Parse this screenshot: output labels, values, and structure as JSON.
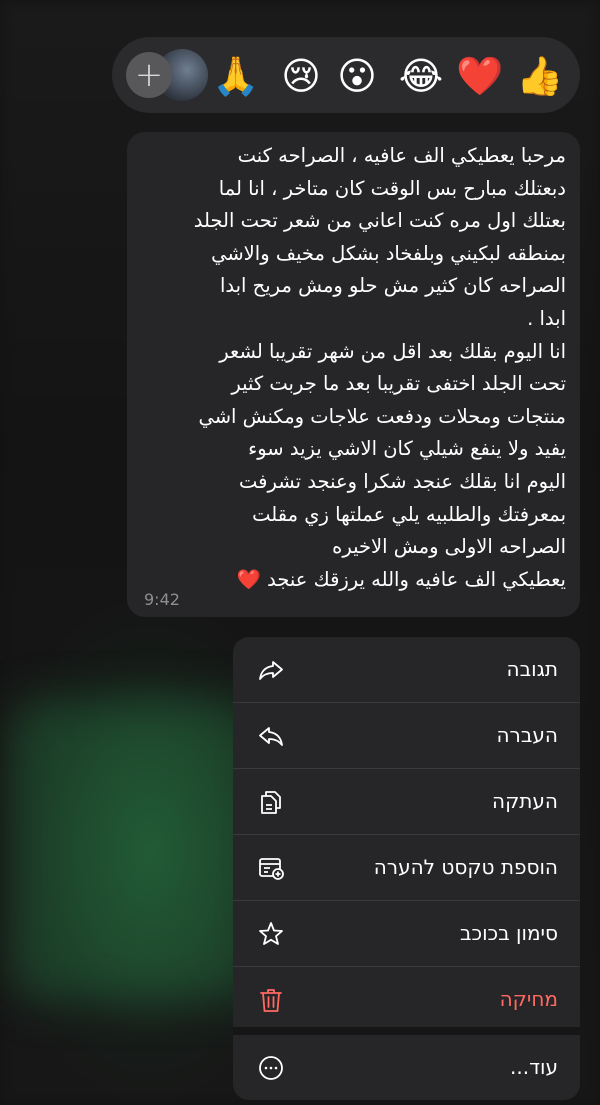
{
  "reactions": {
    "add_label": "+",
    "emojis": [
      "👍",
      "❤️",
      "😂",
      "😮",
      "😢",
      "🙏"
    ]
  },
  "message": {
    "text": "مرحبا يعطيكي الف عافيه ، الصراحه كنت\nدبعتلك مبارح بس الوقت كان متاخر ، انا لما\nبعتلك اول مره كنت اعاني من شعر تحت الجلد\nبمنطقه لبكيني وبلفخاد بشكل مخيف والاشي\nالصراحه كان كثير مش حلو ومش مريح ابدا\nابدا .\nانا اليوم بقلك بعد اقل من شهر تقريبا لشعر\nتحت الجلد اختفى تقريبا بعد ما جربت كثير\nمنتجات ومحلات ودفعت علاجات ومكنش اشي\nيفيد ولا ينفع شيلي كان الاشي يزيد سوء\nاليوم انا بقلك عنجد شكرا وعنجد تشرفت\nبمعرفتك والطلبيه يلي عملتها زي مقلت\nالصراحه الاولى ومش الاخيره\nيعطيكي الف عافيه والله يرزقك عنجد ❤️",
    "time": "9:42"
  },
  "menu": {
    "items": [
      {
        "label": "תגובה",
        "icon": "reply-icon"
      },
      {
        "label": "העברה",
        "icon": "forward-icon"
      },
      {
        "label": "העתקה",
        "icon": "copy-icon"
      },
      {
        "label": "הוספת טקסט להערה",
        "icon": "add-note-icon"
      },
      {
        "label": "סימון בכוכב",
        "icon": "star-icon"
      },
      {
        "label": "מחיקה",
        "icon": "trash-icon"
      },
      {
        "label": "עוד...",
        "icon": "more-icon"
      }
    ],
    "danger_color": "#ff6961"
  }
}
